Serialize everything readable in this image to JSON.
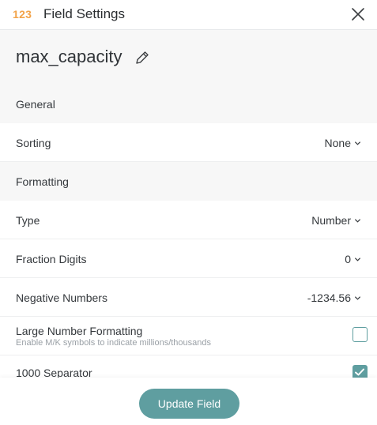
{
  "header": {
    "type_badge": "123",
    "title": "Field Settings"
  },
  "field": {
    "name": "max_capacity"
  },
  "sections": {
    "general": "General",
    "formatting": "Formatting"
  },
  "settings": {
    "sorting": {
      "label": "Sorting",
      "value": "None"
    },
    "type": {
      "label": "Type",
      "value": "Number"
    },
    "fraction_digits": {
      "label": "Fraction Digits",
      "value": "0"
    },
    "negative_numbers": {
      "label": "Negative Numbers",
      "value": "-1234.56"
    },
    "large_number_formatting": {
      "label": "Large Number Formatting",
      "description": "Enable M/K symbols to indicate millions/thousands",
      "checked": false
    },
    "thousand_separator": {
      "label": "1000 Separator",
      "checked": true
    }
  },
  "footer": {
    "update_label": "Update Field"
  },
  "colors": {
    "accent": "#5f9ea0",
    "badge": "#f2a349"
  }
}
